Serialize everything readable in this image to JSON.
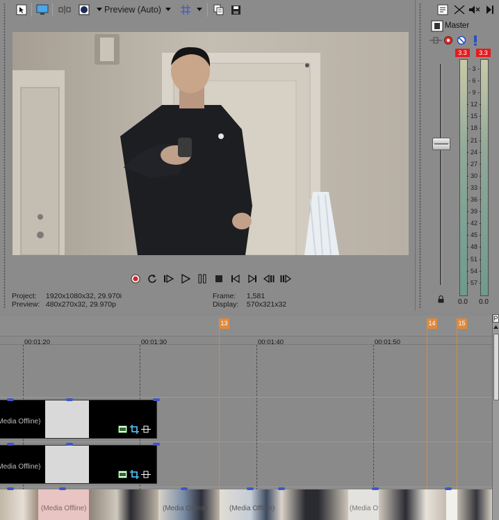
{
  "toolbar": {
    "preview_quality": "Preview (Auto)",
    "buttons": [
      "properties-icon",
      "external-monitor-icon",
      "split-screen-icon",
      "overlay-icon",
      "grid-icon",
      "copy-snapshot-icon",
      "save-snapshot-icon"
    ]
  },
  "preview_info": {
    "project_label": "Project:",
    "project_value": "1920x1080x32, 29.970i",
    "preview_label": "Preview:",
    "preview_value": "480x270x32, 29.970p",
    "frame_label": "Frame:",
    "frame_value": "1,581",
    "display_label": "Display:",
    "display_value": "570x321x32"
  },
  "transport": [
    "record-icon",
    "loop-icon",
    "play-from-start-icon",
    "play-icon",
    "pause-icon",
    "stop-icon",
    "prev-marker-icon",
    "next-marker-icon",
    "prev-frame-icon",
    "next-frame-icon"
  ],
  "master": {
    "title": "Master",
    "peak_left": "3.3",
    "peak_right": "3.3",
    "scale": [
      "3",
      "6",
      "9",
      "12",
      "15",
      "18",
      "21",
      "24",
      "27",
      "30",
      "33",
      "36",
      "39",
      "42",
      "45",
      "48",
      "51",
      "54",
      "57"
    ],
    "meter_left": "0.0",
    "meter_right": "0.0"
  },
  "timeline": {
    "time_labels": [
      "00:01:20",
      "00:01:30",
      "00:01:40",
      "00:01:50"
    ],
    "markers": [
      "13",
      "14",
      "15"
    ],
    "event_text": "(Media Offline)"
  },
  "colors": {
    "marker": "#e08a3c",
    "peak": "#e41c1c",
    "handle": "#3d55c9"
  }
}
